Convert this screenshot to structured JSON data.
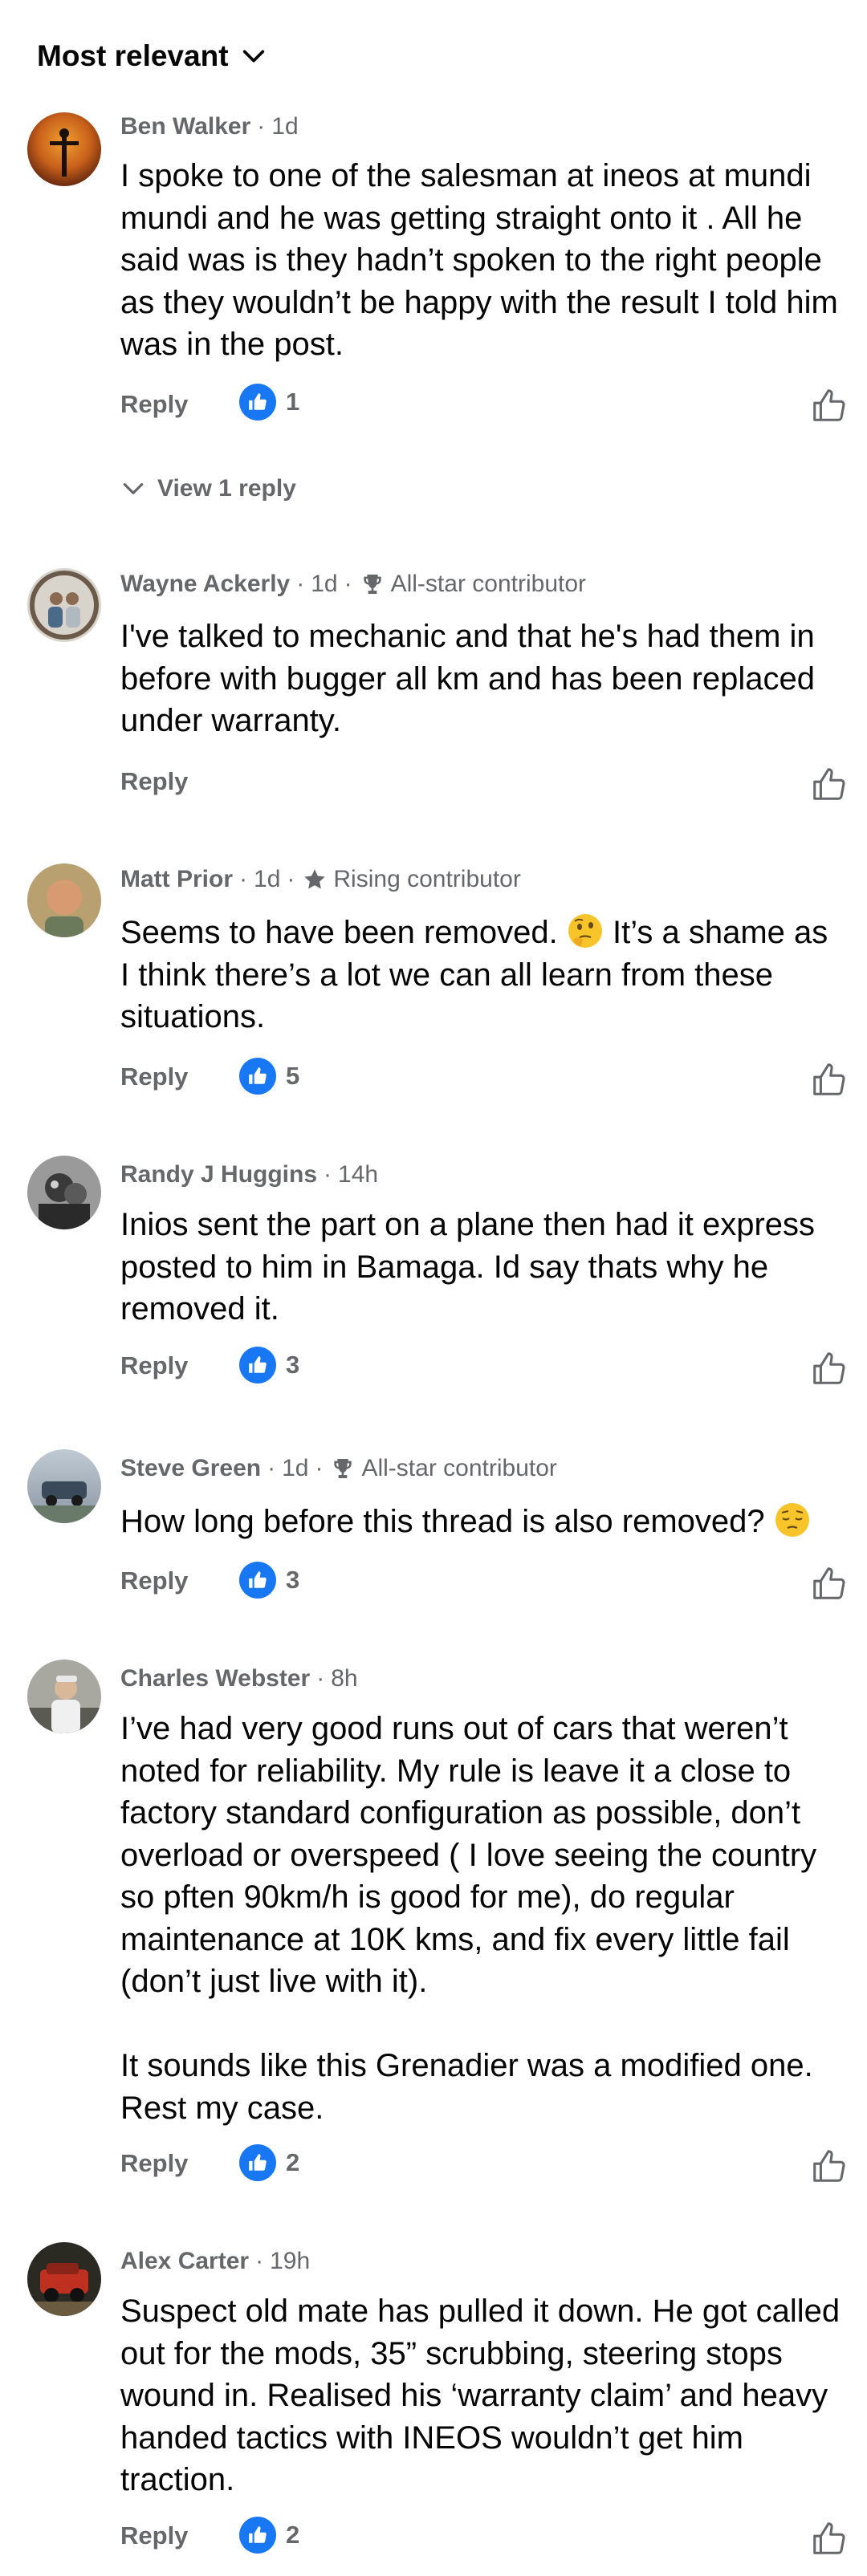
{
  "sort": {
    "label": "Most relevant"
  },
  "comments": [
    {
      "author": "Ben Walker",
      "time": "1d",
      "badge": "",
      "text": "I spoke to one of the salesman at ineos at mundi mundi and he was getting straight onto it . All he said was is they hadn’t spoken to the right people as they wouldn’t be happy with the result I told him was in the post.",
      "reply_label": "Reply",
      "likes": "1",
      "view_replies": "View 1 reply"
    },
    {
      "author": "Wayne Ackerly",
      "time": "1d",
      "badge": "All-star contributor",
      "text": "I've talked to mechanic and that he's had them in before with bugger all km and has been replaced under warranty.",
      "reply_label": "Reply",
      "likes": ""
    },
    {
      "author": "Matt Prior",
      "time": "1d",
      "badge": "Rising contributor",
      "text_before_emoji": "Seems to have been removed. ",
      "text_after_emoji": " It’s a shame as I think there’s a lot we can all learn from these situations.",
      "emoji": "thinking-face-emoji",
      "reply_label": "Reply",
      "likes": "5"
    },
    {
      "author": "Randy J Huggins",
      "time": "14h",
      "badge": "",
      "text": "Inios sent the part on a plane then had it express posted to him in Bamaga. Id say thats why he removed it.",
      "reply_label": "Reply",
      "likes": "3"
    },
    {
      "author": "Steve Green",
      "time": "1d",
      "badge": "All-star contributor",
      "text_before_emoji": "How long before this thread is also removed? ",
      "emoji": "pensive-face-emoji",
      "reply_label": "Reply",
      "likes": "3"
    },
    {
      "author": "Charles Webster",
      "time": "8h",
      "badge": "",
      "text": "I’ve had very good runs out of cars that weren’t noted for reliability. My rule is leave it a close to factory standard configuration as possible, don’t overload or overspeed ( I love seeing the country so pften 90km/h is good for me), do regular maintenance at 10K kms, and fix every little fail (don’t just live with it).\n\nIt sounds like this Grenadier was a modified one. Rest my case.",
      "reply_label": "Reply",
      "likes": "2"
    },
    {
      "author": "Alex Carter",
      "time": "19h",
      "badge": "",
      "text": "Suspect old mate has pulled it down. He got called out for the mods, 35” scrubbing, steering stops wound in. Realised his ‘warranty claim’ and heavy handed tactics with INEOS wouldn’t get him traction.",
      "reply_label": "Reply",
      "likes": "2"
    }
  ],
  "colors": {
    "text": "#050505",
    "meta": "#65676b",
    "like_blue": "#1877f2"
  }
}
